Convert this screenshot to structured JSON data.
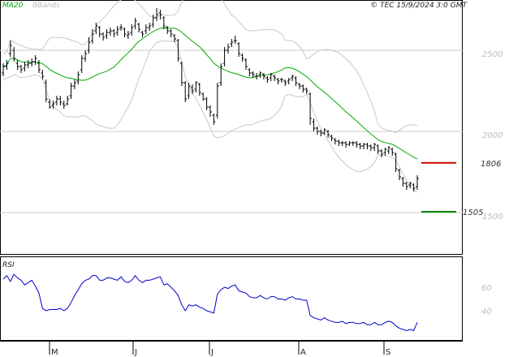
{
  "header": {
    "indicator_1": "MA20",
    "indicator_2": "BBands",
    "credit": "© TEC 15/9/2024 3:0 GMT"
  },
  "colors": {
    "price_bars": "#000000",
    "ma20": "#00aa00",
    "bbands": "#c8c8c8",
    "resistance": "#cc0000",
    "support": "#008800",
    "rsi": "#0000cc",
    "grid": "#cccccc"
  },
  "chart_data": [
    {
      "type": "ohlc",
      "panel": "price",
      "categories": [
        "M",
        "J",
        "J",
        "A",
        "S"
      ],
      "yaxis_ticks": [
        1500,
        2000,
        2500
      ],
      "ylim": [
        1250,
        2800
      ],
      "grid": true,
      "resistance": {
        "value": 1806,
        "label": "1806"
      },
      "support": {
        "value": 1505,
        "label": "1505"
      },
      "close": [
        2400,
        2420,
        2530,
        2450,
        2400,
        2380,
        2410,
        2420,
        2430,
        2450,
        2380,
        2340,
        2200,
        2150,
        2170,
        2200,
        2180,
        2160,
        2200,
        2280,
        2300,
        2350,
        2450,
        2480,
        2550,
        2600,
        2650,
        2600,
        2580,
        2610,
        2620,
        2600,
        2630,
        2640,
        2600,
        2600,
        2640,
        2680,
        2630,
        2600,
        2640,
        2650,
        2700,
        2720,
        2720,
        2650,
        2620,
        2600,
        2570,
        2450,
        2300,
        2200,
        2280,
        2250,
        2300,
        2240,
        2200,
        2150,
        2120,
        2060,
        2280,
        2400,
        2500,
        2520,
        2550,
        2560,
        2480,
        2450,
        2400,
        2360,
        2350,
        2340,
        2360,
        2340,
        2320,
        2350,
        2330,
        2310,
        2320,
        2300,
        2320,
        2340,
        2300,
        2280,
        2260,
        2250,
        2080,
        2020,
        2000,
        1990,
        2010,
        1980,
        1960,
        1940,
        1930,
        1930,
        1920,
        1930,
        1930,
        1920,
        1910,
        1920,
        1910,
        1900,
        1920,
        1880,
        1860,
        1890,
        1900,
        1870,
        1770,
        1720,
        1680,
        1660,
        1680,
        1650,
        1710
      ],
      "open": [
        2360,
        2400,
        2480,
        2500,
        2420,
        2400,
        2390,
        2410,
        2420,
        2430,
        2420,
        2360,
        2300,
        2180,
        2160,
        2180,
        2200,
        2170,
        2170,
        2220,
        2280,
        2310,
        2380,
        2450,
        2500,
        2560,
        2620,
        2640,
        2600,
        2590,
        2610,
        2620,
        2610,
        2640,
        2630,
        2590,
        2610,
        2650,
        2660,
        2610,
        2620,
        2640,
        2660,
        2700,
        2730,
        2700,
        2640,
        2620,
        2590,
        2560,
        2420,
        2300,
        2220,
        2270,
        2260,
        2290,
        2230,
        2200,
        2150,
        2100,
        2100,
        2300,
        2420,
        2500,
        2540,
        2560,
        2540,
        2470,
        2440,
        2380,
        2360,
        2340,
        2350,
        2350,
        2330,
        2330,
        2340,
        2320,
        2320,
        2310,
        2310,
        2330,
        2330,
        2290,
        2280,
        2260,
        2230,
        2060,
        2020,
        2000,
        1990,
        2000,
        1970,
        1950,
        1940,
        1930,
        1930,
        1920,
        1930,
        1930,
        1920,
        1910,
        1920,
        1910,
        1900,
        1910,
        1880,
        1870,
        1880,
        1890,
        1860,
        1760,
        1710,
        1680,
        1670,
        1670,
        1660
      ],
      "high": [
        2420,
        2440,
        2560,
        2520,
        2440,
        2410,
        2430,
        2440,
        2450,
        2470,
        2440,
        2380,
        2320,
        2200,
        2190,
        2220,
        2220,
        2190,
        2220,
        2300,
        2320,
        2370,
        2470,
        2500,
        2580,
        2630,
        2670,
        2650,
        2610,
        2630,
        2640,
        2630,
        2650,
        2660,
        2640,
        2620,
        2660,
        2700,
        2670,
        2620,
        2660,
        2670,
        2720,
        2760,
        2750,
        2710,
        2650,
        2630,
        2600,
        2570,
        2430,
        2310,
        2300,
        2290,
        2310,
        2300,
        2240,
        2210,
        2160,
        2110,
        2300,
        2420,
        2520,
        2540,
        2570,
        2590,
        2550,
        2480,
        2450,
        2390,
        2370,
        2360,
        2370,
        2360,
        2340,
        2360,
        2350,
        2330,
        2330,
        2320,
        2330,
        2350,
        2340,
        2300,
        2290,
        2270,
        2240,
        2080,
        2030,
        2010,
        2020,
        2010,
        1980,
        1960,
        1950,
        1940,
        1940,
        1940,
        1940,
        1940,
        1930,
        1930,
        1930,
        1920,
        1930,
        1920,
        1890,
        1900,
        1910,
        1900,
        1870,
        1770,
        1720,
        1690,
        1690,
        1680,
        1730
      ],
      "low": [
        2340,
        2380,
        2460,
        2430,
        2380,
        2360,
        2370,
        2390,
        2400,
        2410,
        2360,
        2320,
        2180,
        2140,
        2140,
        2160,
        2160,
        2140,
        2160,
        2200,
        2260,
        2290,
        2360,
        2430,
        2480,
        2540,
        2600,
        2580,
        2560,
        2570,
        2590,
        2580,
        2590,
        2620,
        2580,
        2570,
        2590,
        2630,
        2610,
        2580,
        2600,
        2620,
        2640,
        2680,
        2690,
        2630,
        2600,
        2580,
        2550,
        2430,
        2280,
        2180,
        2200,
        2230,
        2240,
        2220,
        2190,
        2130,
        2090,
        2040,
        2080,
        2280,
        2400,
        2480,
        2520,
        2540,
        2460,
        2430,
        2380,
        2340,
        2330,
        2320,
        2330,
        2320,
        2300,
        2310,
        2310,
        2290,
        2300,
        2280,
        2290,
        2310,
        2280,
        2260,
        2240,
        2230,
        2040,
        2000,
        1980,
        1970,
        1980,
        1960,
        1940,
        1920,
        1910,
        1910,
        1900,
        1910,
        1910,
        1900,
        1890,
        1890,
        1890,
        1880,
        1880,
        1860,
        1840,
        1850,
        1860,
        1850,
        1750,
        1700,
        1660,
        1640,
        1650,
        1630,
        1640
      ]
    },
    {
      "type": "line",
      "panel": "rsi",
      "title": "RSI",
      "yaxis_ticks": [
        40,
        60
      ],
      "ylim": [
        15,
        85
      ],
      "series": [
        {
          "name": "RSI",
          "values": [
            67,
            70,
            65,
            71,
            68,
            66,
            62,
            64,
            66,
            61,
            55,
            42,
            40,
            41,
            41,
            41,
            42,
            40,
            42,
            47,
            53,
            58,
            63,
            66,
            67,
            70,
            70,
            66,
            66,
            68,
            68,
            67,
            66,
            69,
            65,
            64,
            66,
            70,
            66,
            64,
            66,
            66,
            67,
            68,
            69,
            62,
            63,
            60,
            57,
            53,
            45,
            40,
            45,
            44,
            45,
            43,
            42,
            40,
            39,
            38,
            54,
            58,
            60,
            59,
            61,
            62,
            57,
            56,
            55,
            52,
            51,
            51,
            53,
            51,
            50,
            52,
            52,
            50,
            50,
            49,
            51,
            52,
            50,
            50,
            49,
            49,
            36,
            34,
            33,
            32,
            34,
            32,
            31,
            30,
            30,
            31,
            29,
            30,
            30,
            29,
            29,
            30,
            28,
            28,
            30,
            28,
            28,
            30,
            31,
            30,
            27,
            25,
            24,
            23,
            24,
            23,
            30
          ]
        }
      ]
    }
  ]
}
